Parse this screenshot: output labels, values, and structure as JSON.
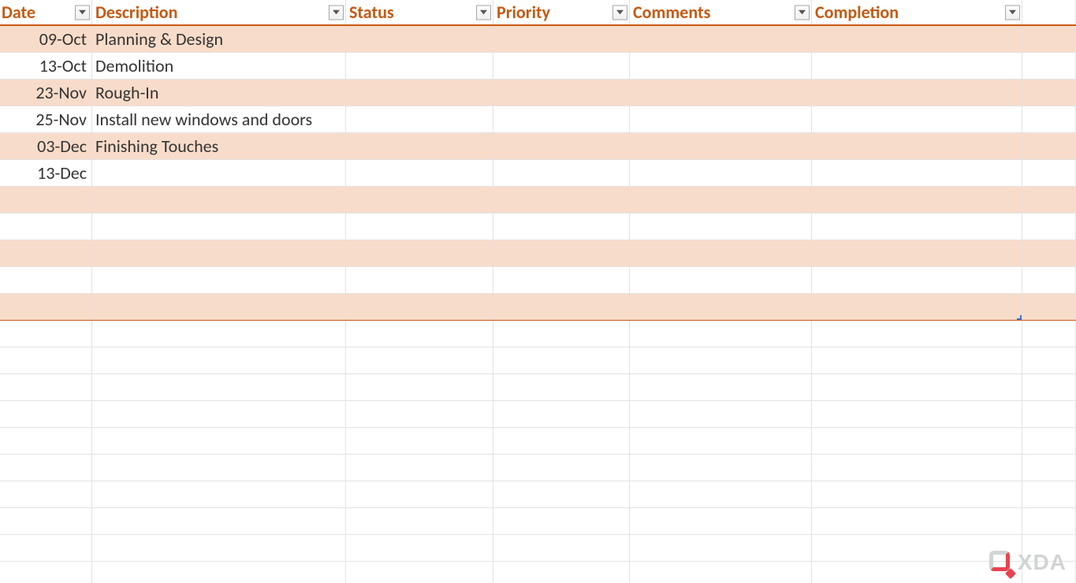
{
  "columns": [
    {
      "key": "date",
      "label": "Date",
      "filter": true
    },
    {
      "key": "description",
      "label": "Description",
      "filter": true
    },
    {
      "key": "status",
      "label": "Status",
      "filter": true
    },
    {
      "key": "priority",
      "label": "Priority",
      "filter": true
    },
    {
      "key": "comments",
      "label": "Comments",
      "filter": true
    },
    {
      "key": "completion",
      "label": "Completion",
      "filter": true
    }
  ],
  "rows": [
    {
      "date": "09-Oct",
      "description": "Planning & Design",
      "status": "",
      "priority": "",
      "comments": "",
      "completion": ""
    },
    {
      "date": "13-Oct",
      "description": "Demolition",
      "status": "",
      "priority": "",
      "comments": "",
      "completion": ""
    },
    {
      "date": "23-Nov",
      "description": "Rough-In",
      "status": "",
      "priority": "",
      "comments": "",
      "completion": ""
    },
    {
      "date": "25-Nov",
      "description": "Install new windows and doors",
      "status": "",
      "priority": "",
      "comments": "",
      "completion": ""
    },
    {
      "date": "03-Dec",
      "description": "Finishing Touches",
      "status": "",
      "priority": "",
      "comments": "",
      "completion": ""
    },
    {
      "date": "13-Dec",
      "description": "",
      "status": "",
      "priority": "",
      "comments": "",
      "completion": ""
    },
    {
      "date": "",
      "description": "",
      "status": "",
      "priority": "",
      "comments": "",
      "completion": ""
    },
    {
      "date": "",
      "description": "",
      "status": "",
      "priority": "",
      "comments": "",
      "completion": ""
    },
    {
      "date": "",
      "description": "",
      "status": "",
      "priority": "",
      "comments": "",
      "completion": ""
    },
    {
      "date": "",
      "description": "",
      "status": "",
      "priority": "",
      "comments": "",
      "completion": ""
    },
    {
      "date": "",
      "description": "",
      "status": "",
      "priority": "",
      "comments": "",
      "completion": ""
    }
  ],
  "empty_rows_after_table": 10,
  "watermark": {
    "brand": "XDA"
  },
  "colors": {
    "accent": "#c65911",
    "band_odd": "#f8dcca",
    "band_even": "#ffffff",
    "grid": "#e2e2e2"
  }
}
